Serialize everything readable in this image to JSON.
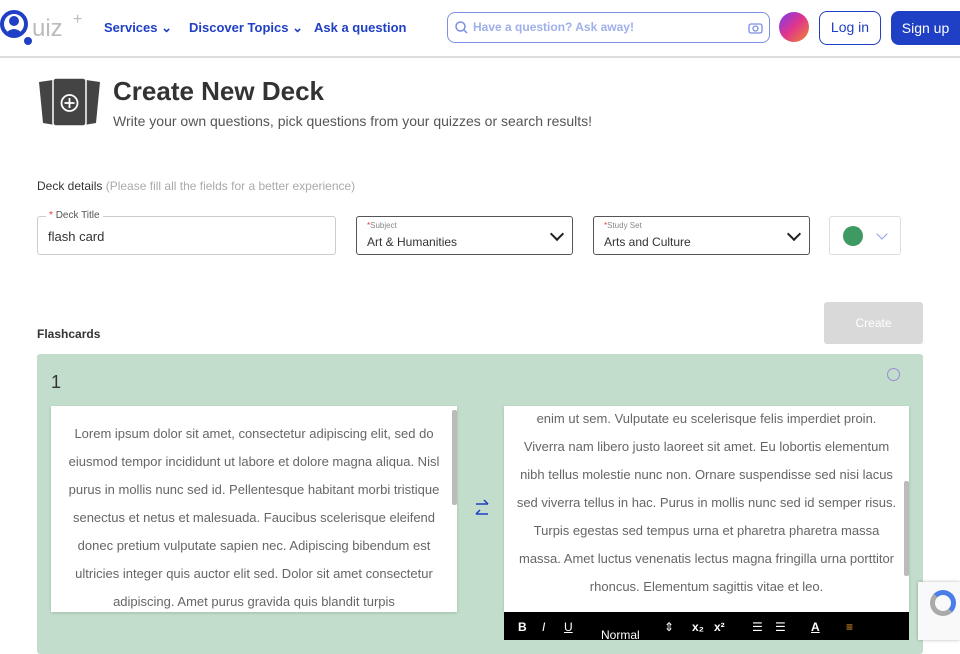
{
  "header": {
    "logo": "Quiz+",
    "nav": [
      {
        "label": "Services"
      },
      {
        "label": "Discover Topics"
      },
      {
        "label": "Ask a question"
      }
    ],
    "search_placeholder": "Have a question? Ask away!",
    "login": "Log in",
    "signup": "Sign up"
  },
  "page": {
    "title": "Create New Deck",
    "subtitle": "Write your own questions, pick questions from your quizzes or search results!"
  },
  "deck_details": {
    "label": "Deck details",
    "hint": "(Please fill all the fields for a better experience)",
    "title_label": "Deck Title",
    "title_value": "flash card",
    "subject_label": "Subject",
    "subject_value": "Art & Humanities",
    "studyset_label": "Study Set",
    "studyset_value": "Arts and Culture",
    "color": "#3e9a62"
  },
  "flashcards": {
    "label": "Flashcards",
    "create": "Create",
    "cards": [
      {
        "number": "1",
        "front": "Lorem ipsum dolor sit amet, consectetur adipiscing elit, sed do eiusmod tempor incididunt ut labore et dolore magna aliqua. Nisl purus in mollis nunc sed id. Pellentesque habitant morbi tristique senectus et netus et malesuada. Faucibus scelerisque eleifend donec pretium vulputate sapien nec. Adipiscing bibendum est ultricies integer quis auctor elit sed. Dolor sit amet consectetur adipiscing. Amet purus gravida quis blandit turpis",
        "back": "enim ut sem. Vulputate eu scelerisque felis imperdiet proin. Viverra nam libero justo laoreet sit amet. Eu lobortis elementum nibh tellus molestie nunc non. Ornare suspendisse sed nisi lacus sed viverra tellus in hac. Purus in mollis nunc sed id semper risus. Turpis egestas sed tempus urna et pharetra pharetra massa massa. Amet luctus venenatis lectus magna fringilla urna porttitor rhoncus. Elementum sagittis vitae et leo."
      }
    ]
  },
  "toolbar": {
    "bold": "B",
    "italic": "I",
    "underline": "U",
    "format": "Normal",
    "sub": "x₂",
    "sup": "x²"
  }
}
